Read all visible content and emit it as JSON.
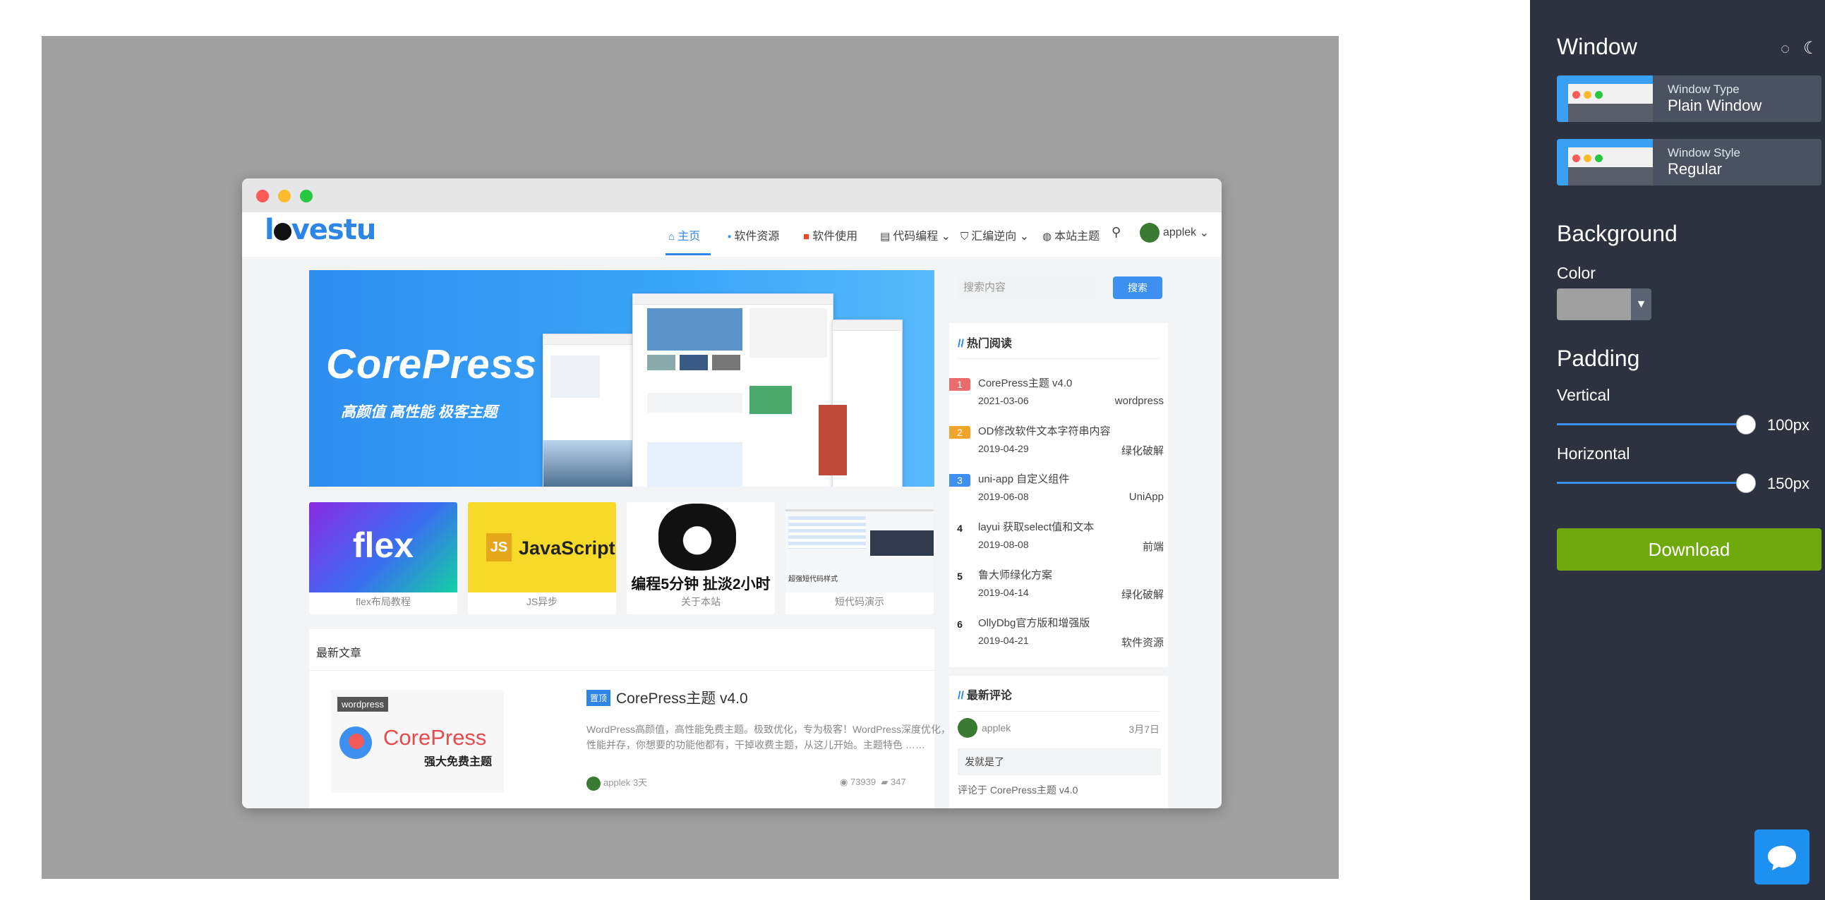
{
  "preview": {
    "logo": {
      "pre": "l",
      "post": "vestu"
    },
    "nav": {
      "home": "主页",
      "software": "软件资源",
      "usage": "软件使用",
      "coding": "代码编程",
      "asm": "汇编逆向",
      "theme": "本站主题",
      "user": "applek"
    },
    "banner": {
      "title": "CorePress",
      "subtitle": "高颜值 高性能 极客主题"
    },
    "cards": [
      {
        "art": "flex",
        "caption": "flex布局教程"
      },
      {
        "art": "JavaScript",
        "art_prefix": "JS",
        "caption": "JS异步"
      },
      {
        "art": "编程5分钟 扯淡2小时",
        "caption": "关于本站"
      },
      {
        "art": "超强短代码样式",
        "caption": "短代码演示"
      }
    ],
    "latest": {
      "heading": "最新文章",
      "post": {
        "category": "wordpress",
        "badge": "置顶",
        "title": "CorePress主题 v4.0",
        "image_text": "CorePress",
        "image_sub": "强大免费主题",
        "excerpt": "WordPress高颜值，高性能免费主题。极致优化，专为极客！WordPress深度优化，颜值与性能并存，你想要的功能他都有，干掉收费主题，从这儿开始。主题特色 ……",
        "author": "applek",
        "time": "3天",
        "views": "73939",
        "comments": "347"
      }
    },
    "sidebar": {
      "search_placeholder": "搜索内容",
      "search_button": "搜索",
      "hot_title": "热门阅读",
      "hot": [
        {
          "rank": "1",
          "title": "CorePress主题 v4.0",
          "date": "2021-03-06",
          "cat": "wordpress",
          "color": "#e96b6b"
        },
        {
          "rank": "2",
          "title": "OD修改软件文本字符串内容",
          "date": "2019-04-29",
          "cat": "绿化破解",
          "color": "#f0a42a"
        },
        {
          "rank": "3",
          "title": "uni-app 自定义组件",
          "date": "2019-06-08",
          "cat": "UniApp",
          "color": "#3d8ff0"
        },
        {
          "rank": "4",
          "title": "layui 获取select值和文本",
          "date": "2019-08-08",
          "cat": "前端",
          "color": ""
        },
        {
          "rank": "5",
          "title": "鲁大师绿化方案",
          "date": "2019-04-14",
          "cat": "绿化破解",
          "color": ""
        },
        {
          "rank": "6",
          "title": "OllyDbg官方版和增强版",
          "date": "2019-04-21",
          "cat": "软件资源",
          "color": ""
        }
      ],
      "comments_title": "最新评论",
      "comment": {
        "user": "applek",
        "date": "3月7日",
        "text": "发就是了",
        "on": "评论于 CorePress主题 v4.0"
      }
    }
  },
  "panel": {
    "window_heading": "Window",
    "window_type_key": "Window Type",
    "window_type_value": "Plain Window",
    "window_style_key": "Window Style",
    "window_style_value": "Regular",
    "background_heading": "Background",
    "color_label": "Color",
    "background_color": "#a0a0a0",
    "padding_heading": "Padding",
    "vertical_label": "Vertical",
    "vertical_value": "100px",
    "horizontal_label": "Horizontal",
    "horizontal_value": "150px",
    "download_label": "Download"
  }
}
